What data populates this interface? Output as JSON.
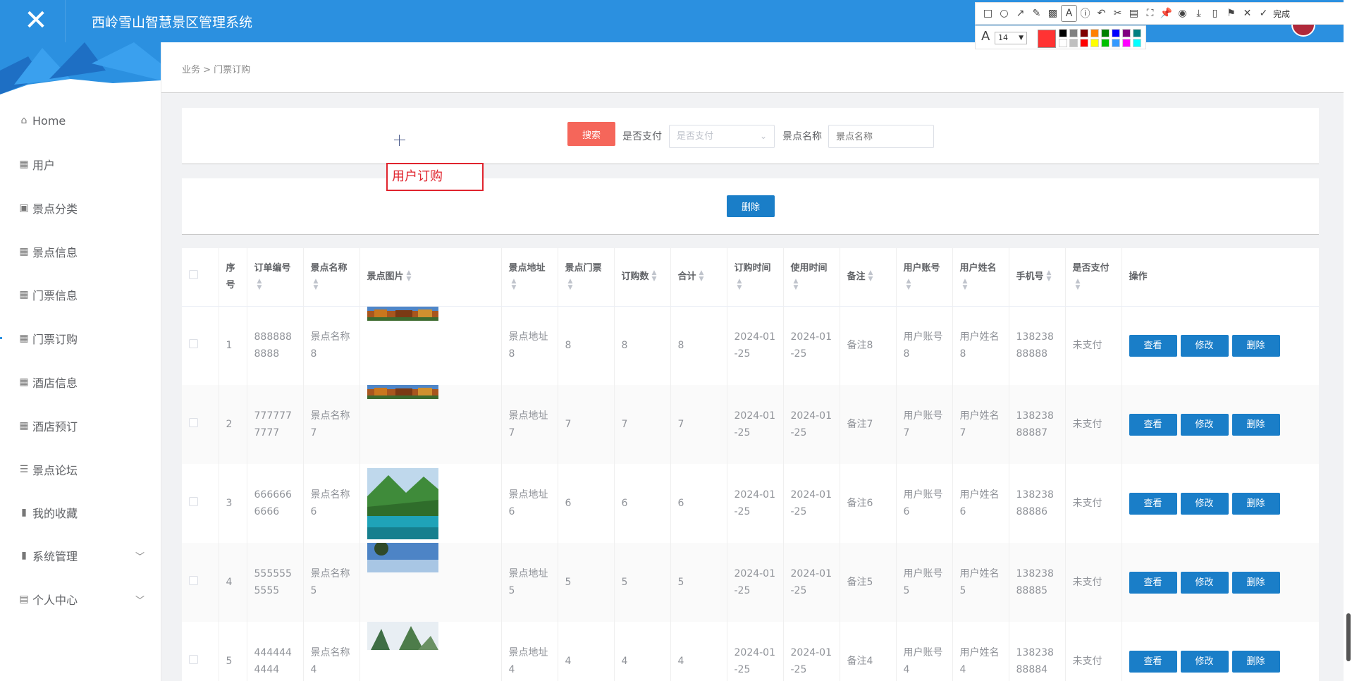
{
  "header": {
    "title": "西岭雪山智慧景区管理系统",
    "close_icon": "close-icon"
  },
  "sidebar": {
    "items": [
      {
        "label": "Home",
        "icon": "home-icon",
        "has_children": false
      },
      {
        "label": "用户",
        "icon": "grid-icon",
        "has_children": false
      },
      {
        "label": "景点分类",
        "icon": "clipboard-icon",
        "has_children": false
      },
      {
        "label": "景点信息",
        "icon": "grid-icon",
        "has_children": false
      },
      {
        "label": "门票信息",
        "icon": "grid-icon",
        "has_children": false
      },
      {
        "label": "门票订购",
        "icon": "grid-icon",
        "has_children": false
      },
      {
        "label": "酒店信息",
        "icon": "grid-icon",
        "has_children": false
      },
      {
        "label": "酒店预订",
        "icon": "grid-icon",
        "has_children": false
      },
      {
        "label": "景点论坛",
        "icon": "list-icon",
        "has_children": false
      },
      {
        "label": "我的收藏",
        "icon": "bar-chart-icon",
        "has_children": false
      },
      {
        "label": "系统管理",
        "icon": "bar-chart-icon",
        "has_children": true
      },
      {
        "label": "个人中心",
        "icon": "calendar-icon",
        "has_children": true
      }
    ]
  },
  "breadcrumb": "业务 > 门票订购",
  "search": {
    "button_label": "搜索",
    "pay_label": "是否支付",
    "pay_placeholder": "是否支付",
    "name_label": "景点名称",
    "name_placeholder": "景点名称"
  },
  "annotation_text": "用户订购",
  "actions": {
    "delete_label": "删除"
  },
  "table": {
    "columns": [
      {
        "label": "",
        "sortable": false
      },
      {
        "label": "序号",
        "sortable": false
      },
      {
        "label": "订单编号",
        "sortable": true
      },
      {
        "label": "景点名称",
        "sortable": true
      },
      {
        "label": "景点图片",
        "sortable": true
      },
      {
        "label": "景点地址",
        "sortable": true
      },
      {
        "label": "景点门票",
        "sortable": true
      },
      {
        "label": "订购数",
        "sortable": true
      },
      {
        "label": "合计",
        "sortable": true
      },
      {
        "label": "订购时间",
        "sortable": true
      },
      {
        "label": "使用时间",
        "sortable": true
      },
      {
        "label": "备注",
        "sortable": true
      },
      {
        "label": "用户账号",
        "sortable": true
      },
      {
        "label": "用户姓名",
        "sortable": true
      },
      {
        "label": "手机号",
        "sortable": true
      },
      {
        "label": "是否支付",
        "sortable": true
      },
      {
        "label": "操作",
        "sortable": false
      }
    ],
    "op_labels": {
      "view": "查看",
      "edit": "修改",
      "delete": "删除"
    },
    "rows": [
      {
        "index": "1",
        "order_no": "8888888888",
        "name": "景点名称8",
        "image": "autumn-forest-strip",
        "address": "景点地址8",
        "ticket": "8",
        "qty": "8",
        "total": "8",
        "order_time": "2024-01-25",
        "use_time": "2024-01-25",
        "note": "备注8",
        "account": "用户账号8",
        "username": "用户姓名8",
        "phone": "13823888888",
        "paid": "未支付"
      },
      {
        "index": "2",
        "order_no": "7777777777",
        "name": "景点名称7",
        "image": "autumn-forest-strip",
        "address": "景点地址7",
        "ticket": "7",
        "qty": "7",
        "total": "7",
        "order_time": "2024-01-25",
        "use_time": "2024-01-25",
        "note": "备注7",
        "account": "用户账号7",
        "username": "用户姓名7",
        "phone": "13823888887",
        "paid": "未支付"
      },
      {
        "index": "3",
        "order_no": "6666666666",
        "name": "景点名称6",
        "image": "mountain-lake",
        "address": "景点地址6",
        "ticket": "6",
        "qty": "6",
        "total": "6",
        "order_time": "2024-01-25",
        "use_time": "2024-01-25",
        "note": "备注6",
        "account": "用户账号6",
        "username": "用户姓名6",
        "phone": "13823888886",
        "paid": "未支付"
      },
      {
        "index": "4",
        "order_no": "5555555555",
        "name": "景点名称5",
        "image": "blue-sky-strip",
        "address": "景点地址5",
        "ticket": "5",
        "qty": "5",
        "total": "5",
        "order_time": "2024-01-25",
        "use_time": "2024-01-25",
        "note": "备注5",
        "account": "用户账号5",
        "username": "用户姓名5",
        "phone": "13823888885",
        "paid": "未支付"
      },
      {
        "index": "5",
        "order_no": "4444444444",
        "name": "景点名称4",
        "image": "karst-peaks-strip",
        "address": "景点地址4",
        "ticket": "4",
        "qty": "4",
        "total": "4",
        "order_time": "2024-01-25",
        "use_time": "2024-01-25",
        "note": "备注4",
        "account": "用户账号4",
        "username": "用户姓名4",
        "phone": "13823888884",
        "paid": "未支付"
      }
    ]
  },
  "snip_toolbar": {
    "tools": [
      "rect-icon",
      "ellipse-icon",
      "arrow-icon",
      "pen-icon",
      "mosaic-icon",
      "text-icon",
      "number-icon",
      "undo-icon",
      "scissors-icon",
      "ocr-icon",
      "fullscreen-icon",
      "pin-icon",
      "record-icon",
      "download-icon",
      "phone-icon",
      "bookmark-icon",
      "close-icon",
      "check-icon"
    ],
    "done_label": "完成",
    "font_size": "14",
    "current_color": "#ff3333",
    "swatches": [
      "#000000",
      "#808080",
      "#800000",
      "#ff8000",
      "#008000",
      "#0000ff",
      "#800080",
      "#008080",
      "#ffffff",
      "#c0c0c0",
      "#ff0000",
      "#ffff00",
      "#00c000",
      "#3399ff",
      "#ff00ff",
      "#00ffff"
    ]
  },
  "colors": {
    "header": "#2b90e0",
    "primary_button": "#1a7ec8",
    "search_button": "#f5665a"
  }
}
